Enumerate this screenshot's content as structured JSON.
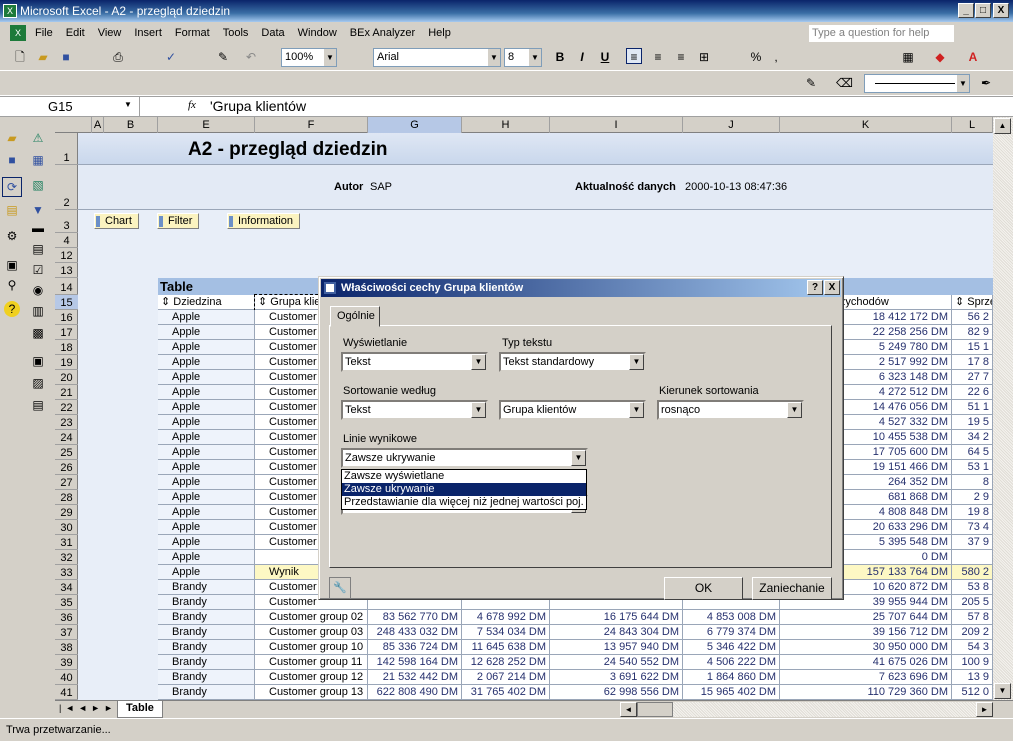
{
  "window": {
    "title": "Microsoft Excel - A2 - przegląd dziedzin",
    "min": "_",
    "max": "□",
    "close": "X"
  },
  "menu": {
    "items": [
      "File",
      "Edit",
      "View",
      "Insert",
      "Format",
      "Tools",
      "Data",
      "Window",
      "BEx Analyzer",
      "Help"
    ],
    "help_placeholder": "Type a question for help"
  },
  "toolbar": {
    "zoom": "100%",
    "font": "Arial",
    "size": "8",
    "bold": "B",
    "italic": "I",
    "underline": "U",
    "percent": "%",
    "comma": ","
  },
  "formula": {
    "namebox": "G15",
    "fx": "fx",
    "value": "'Grupa klientów"
  },
  "columns": [
    "A",
    "B",
    "E",
    "F",
    "G",
    "H",
    "I",
    "J",
    "K",
    "L"
  ],
  "row_numbers": [
    "1",
    "2",
    "3",
    "4",
    "12",
    "13",
    "14",
    "15",
    "16",
    "17",
    "18",
    "19",
    "20",
    "21",
    "22",
    "23",
    "24",
    "25",
    "26",
    "27",
    "28",
    "29",
    "30",
    "31",
    "32",
    "33",
    "34",
    "35",
    "36",
    "37",
    "38",
    "39",
    "40",
    "41"
  ],
  "sheet": {
    "title": "A2 - przegląd dziedzin",
    "author_label": "Autor",
    "author": "SAP",
    "date_label": "Aktualność danych",
    "date": "2000-10-13 08:47:36",
    "buttons": [
      "Chart",
      "Filter",
      "Information"
    ],
    "table_title": "Table",
    "headers": {
      "F": "Dziedzina",
      "G": "Grupa klie",
      "L": "ejszeń przychodów",
      "M": "Sprze"
    },
    "rows": [
      [
        "Apple",
        "Customer",
        "",
        "",
        "",
        "",
        "18 412 172 DM",
        "56 2"
      ],
      [
        "Apple",
        "Customer",
        "",
        "",
        "",
        "",
        "22 258 256 DM",
        "82 9"
      ],
      [
        "Apple",
        "Customer",
        "",
        "",
        "",
        "",
        "5 249 780 DM",
        "15 1"
      ],
      [
        "Apple",
        "Customer",
        "",
        "",
        "",
        "",
        "2 517 992 DM",
        "17 8"
      ],
      [
        "Apple",
        "Customer",
        "",
        "",
        "",
        "",
        "6 323 148 DM",
        "27 7"
      ],
      [
        "Apple",
        "Customer",
        "",
        "",
        "",
        "",
        "4 272 512 DM",
        "22 6"
      ],
      [
        "Apple",
        "Customer",
        "",
        "",
        "",
        "",
        "14 476 056 DM",
        "51 1"
      ],
      [
        "Apple",
        "Customer",
        "",
        "",
        "",
        "",
        "4 527 332 DM",
        "19 5"
      ],
      [
        "Apple",
        "Customer",
        "",
        "",
        "",
        "",
        "10 455 538 DM",
        "34 2"
      ],
      [
        "Apple",
        "Customer",
        "",
        "",
        "",
        "",
        "17 705 600 DM",
        "64 5"
      ],
      [
        "Apple",
        "Customer",
        "",
        "",
        "",
        "",
        "19 151 466 DM",
        "53 1"
      ],
      [
        "Apple",
        "Customer",
        "",
        "",
        "",
        "",
        "264 352 DM",
        "8"
      ],
      [
        "Apple",
        "Customer",
        "",
        "",
        "",
        "",
        "681 868 DM",
        "2 9"
      ],
      [
        "Apple",
        "Customer",
        "",
        "",
        "",
        "",
        "4 808 848 DM",
        "19 8"
      ],
      [
        "Apple",
        "Customer",
        "",
        "",
        "",
        "",
        "20 633 296 DM",
        "73 4"
      ],
      [
        "Apple",
        "Customer",
        "",
        "",
        "",
        "",
        "5 395 548 DM",
        "37 9"
      ],
      [
        "Apple",
        "",
        "",
        "",
        "",
        "",
        "0 DM",
        ""
      ],
      [
        "Apple",
        "Wynik",
        "",
        "",
        "",
        "",
        "157 133 764 DM",
        "580 2"
      ],
      [
        "Brandy",
        "Customer",
        "",
        "",
        "",
        "",
        "10 620 872 DM",
        "53 8"
      ],
      [
        "Brandy",
        "Customer",
        "",
        "",
        "",
        "",
        "39 955 944 DM",
        "205 5"
      ],
      [
        "Brandy",
        "Customer group 02",
        "83 562 770 DM",
        "4 678 992 DM",
        "16 175 644 DM",
        "4 853 008 DM",
        "25 707 644 DM",
        "57 8"
      ],
      [
        "Brandy",
        "Customer group 03",
        "248 433 032 DM",
        "7 534 034 DM",
        "24 843 304 DM",
        "6 779 374 DM",
        "39 156 712 DM",
        "209 2"
      ],
      [
        "Brandy",
        "Customer group 10",
        "85 336 724 DM",
        "11 645 638 DM",
        "13 957 940 DM",
        "5 346 422 DM",
        "30 950 000 DM",
        "54 3"
      ],
      [
        "Brandy",
        "Customer group 11",
        "142 598 164 DM",
        "12 628 252 DM",
        "24 540 552 DM",
        "4 506 222 DM",
        "41 675 026 DM",
        "100 9"
      ],
      [
        "Brandy",
        "Customer group 12",
        "21 532 442 DM",
        "2 067 214 DM",
        "3 691 622 DM",
        "1 864 860 DM",
        "7 623 696 DM",
        "13 9"
      ],
      [
        "Brandy",
        "Customer group 13",
        "622 808 490 DM",
        "31 765 402 DM",
        "62 998 556 DM",
        "15 965 402 DM",
        "110 729 360 DM",
        "512 0"
      ]
    ]
  },
  "dialog": {
    "title": "Właściwości cechy Grupa klientów",
    "help": "?",
    "close": "X",
    "tab": "Ogólnie",
    "display_label": "Wyświetlanie",
    "display_value": "Tekst",
    "text_type_label": "Typ tekstu",
    "text_type_value": "Tekst standardowy",
    "sort_by_label": "Sortowanie według",
    "sort_by_value": "Tekst",
    "sort_attr_value": "Grupa klientów",
    "sort_dir_label": "Kierunek sortowania",
    "sort_dir_value": "rosnąco",
    "result_label": "Linie wynikowe",
    "result_value": "Zawsze ukrywanie",
    "options": [
      "Zawsze wyświetlane",
      "Zawsze ukrywanie",
      "Przedstawianie dla więcej niż jednej wartości poj."
    ],
    "selected_option": 1,
    "ok": "OK",
    "cancel": "Zaniechanie"
  },
  "sheet_tab": "Table",
  "status": "Trwa przetwarzanie..."
}
